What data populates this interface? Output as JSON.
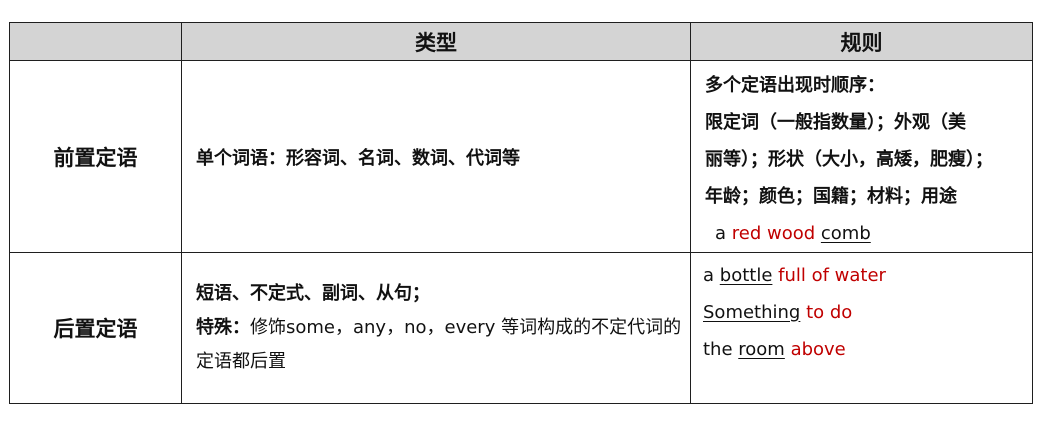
{
  "header": {
    "col1": "",
    "col2": "类型",
    "col3": "规则"
  },
  "rows": [
    {
      "name": "前置定语",
      "type": "单个词语：形容词、名词、数词、代词等",
      "rule_lines": [
        "多个定语出现时顺序：",
        "限定词（一般指数量）；外观（美",
        "丽等）；形状（大小，高矮，肥瘦）；",
        "年龄；颜色；国籍；材料；用途"
      ],
      "example": {
        "lead": "a ",
        "modifiers": "red wood ",
        "noun": "comb"
      }
    },
    {
      "name": "后置定语",
      "type_line1": "短语、不定式、副词、从句；",
      "type_label": "特殊：",
      "type_text": "修饰some，any，no，every 等词构成的不定代词的定语都后置",
      "examples": [
        {
          "lead": "a ",
          "noun": "bottle",
          "modifier": " full of water"
        },
        {
          "lead": "",
          "noun": "Something",
          "modifier": " to do"
        },
        {
          "lead": "the ",
          "noun": "room",
          "modifier": " above"
        }
      ]
    }
  ],
  "colors": {
    "header_bg": "#d4d4d4",
    "example_red": "#c00000",
    "border": "#1f1f1f"
  }
}
